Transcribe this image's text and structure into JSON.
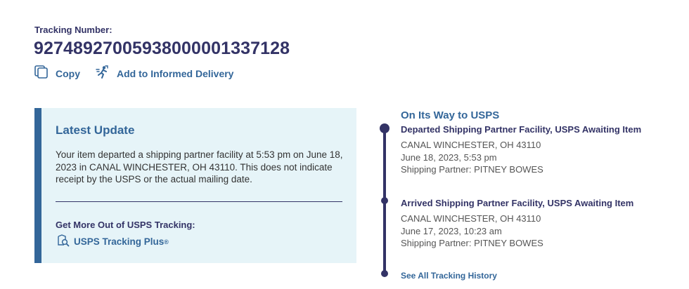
{
  "tracking": {
    "label": "Tracking Number:",
    "number": "9274892700593800000133712​8"
  },
  "actions": {
    "copy_label": "Copy",
    "informed_label": "Add to Informed Delivery"
  },
  "latest_update": {
    "title": "Latest Update",
    "text": "Your item departed a shipping partner facility at 5:53 pm on June 18, 2023 in CANAL WINCHESTER, OH 43110. This does not indicate receipt by the USPS or the actual mailing date.",
    "more_title": "Get More Out of USPS Tracking:",
    "plus_label": "USPS Tracking Plus",
    "plus_mark": "®"
  },
  "timeline": {
    "status_title": "On Its Way to USPS",
    "events": [
      {
        "title": "Departed Shipping Partner Facility, USPS Awaiting Item",
        "location": "CANAL WINCHESTER, OH 43110",
        "datetime": "June 18, 2023, 5:53 pm",
        "partner": "Shipping Partner: PITNEY BOWES"
      },
      {
        "title": "Arrived Shipping Partner Facility, USPS Awaiting Item",
        "location": "CANAL WINCHESTER, OH 43110",
        "datetime": "June 17, 2023, 10:23 am",
        "partner": "Shipping Partner: PITNEY BOWES"
      }
    ],
    "history_label": "See All Tracking History"
  },
  "icons": {
    "copy": "copy-icon",
    "informed": "informed-delivery-icon",
    "plus": "tracking-plus-icon"
  },
  "colors": {
    "navy": "#333366",
    "link_blue": "#336699",
    "panel_bg": "#e6f4f8"
  }
}
